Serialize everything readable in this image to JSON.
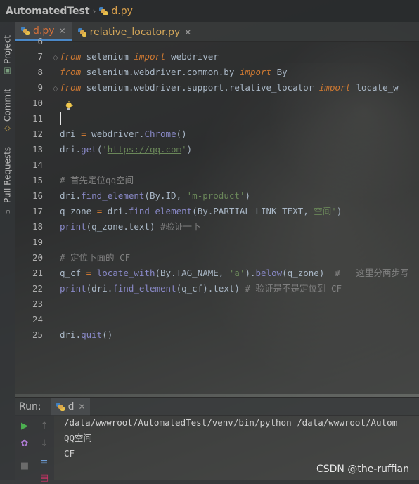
{
  "nav": {
    "project": "AutomatedTest",
    "file": "d.py"
  },
  "side_tabs": {
    "project": "Project",
    "commit": "Commit",
    "pull_requests": "Pull Requests"
  },
  "tabs": [
    {
      "label": "d.py",
      "active": true,
      "icon": "python-file-icon"
    },
    {
      "label": "relative_locator.py",
      "active": false,
      "icon": "python-file-icon"
    }
  ],
  "editor": {
    "lines": [
      {
        "num": "6",
        "segments": []
      },
      {
        "num": "7",
        "segments": [
          [
            "kw",
            "from"
          ],
          [
            "pl",
            " selenium "
          ],
          [
            "kw",
            "import"
          ],
          [
            "pl",
            " webdriver"
          ]
        ]
      },
      {
        "num": "8",
        "segments": [
          [
            "kw",
            "from"
          ],
          [
            "pl",
            " selenium.webdriver.common.by "
          ],
          [
            "kw",
            "import"
          ],
          [
            "pl",
            " By"
          ]
        ]
      },
      {
        "num": "9",
        "segments": [
          [
            "kw",
            "from"
          ],
          [
            "pl",
            " selenium.webdriver.support.relative_locator "
          ],
          [
            "kw",
            "import"
          ],
          [
            "pl",
            " locate_w"
          ]
        ]
      },
      {
        "num": "10",
        "segments": []
      },
      {
        "num": "11",
        "segments": []
      },
      {
        "num": "12",
        "segments": [
          [
            "pl",
            "dri "
          ],
          [
            "kw2",
            "="
          ],
          [
            "pl",
            " webdriver."
          ],
          [
            "bi",
            "Chrome"
          ],
          [
            "pl",
            "()"
          ]
        ]
      },
      {
        "num": "13",
        "segments": [
          [
            "pl",
            "dri."
          ],
          [
            "bi",
            "get"
          ],
          [
            "pl",
            "("
          ],
          [
            "str",
            "'"
          ],
          [
            "url",
            "https://qq.com"
          ],
          [
            "str",
            "'"
          ],
          [
            "pl",
            ")"
          ]
        ]
      },
      {
        "num": "14",
        "segments": []
      },
      {
        "num": "15",
        "segments": [
          [
            "cm",
            "# 首先定位qq空间"
          ]
        ]
      },
      {
        "num": "16",
        "segments": [
          [
            "pl",
            "dri."
          ],
          [
            "bi",
            "find_element"
          ],
          [
            "pl",
            "(By.ID, "
          ],
          [
            "str",
            "'m-product'"
          ],
          [
            "pl",
            ")"
          ]
        ]
      },
      {
        "num": "17",
        "segments": [
          [
            "pl",
            "q_zone "
          ],
          [
            "kw2",
            "="
          ],
          [
            "pl",
            " dri."
          ],
          [
            "bi",
            "find_element"
          ],
          [
            "pl",
            "(By.PARTIAL_LINK_TEXT,"
          ],
          [
            "str",
            "'空间'"
          ],
          [
            "pl",
            ")"
          ]
        ]
      },
      {
        "num": "18",
        "segments": [
          [
            "bi",
            "print"
          ],
          [
            "pl",
            "(q_zone.text) "
          ],
          [
            "cm",
            "#验证一下"
          ]
        ]
      },
      {
        "num": "19",
        "segments": []
      },
      {
        "num": "20",
        "segments": [
          [
            "cm",
            "# 定位下面的 CF"
          ]
        ]
      },
      {
        "num": "21",
        "segments": [
          [
            "pl",
            "q_cf "
          ],
          [
            "kw2",
            "="
          ],
          [
            "pl",
            " "
          ],
          [
            "bi",
            "locate_with"
          ],
          [
            "pl",
            "(By.TAG_NAME, "
          ],
          [
            "str",
            "'a'"
          ],
          [
            "pl",
            ")."
          ],
          [
            "bi",
            "below"
          ],
          [
            "pl",
            "(q_zone)  "
          ],
          [
            "cm",
            "#   这里分两步写"
          ]
        ]
      },
      {
        "num": "22",
        "segments": [
          [
            "bi",
            "print"
          ],
          [
            "pl",
            "(dri."
          ],
          [
            "bi",
            "find_element"
          ],
          [
            "pl",
            "(q_cf).text) "
          ],
          [
            "cm",
            "# 验证是不是定位到 CF"
          ]
        ]
      },
      {
        "num": "23",
        "segments": []
      },
      {
        "num": "24",
        "segments": []
      },
      {
        "num": "25",
        "segments": [
          [
            "pl",
            "dri."
          ],
          [
            "bi",
            "quit"
          ],
          [
            "pl",
            "()"
          ]
        ]
      }
    ]
  },
  "run": {
    "title": "Run:",
    "config": "d",
    "output": [
      "/data/wwwroot/AutomatedTest/venv/bin/python /data/wwwroot/Autom",
      "QQ空间",
      "CF"
    ]
  },
  "watermark": "CSDN @the-ruffian",
  "colors": {
    "keyword": "#cc7832",
    "string": "#6a8759",
    "builtin": "#8888c6",
    "comment": "#808080",
    "tab_active_underline": "#4a88c7"
  }
}
